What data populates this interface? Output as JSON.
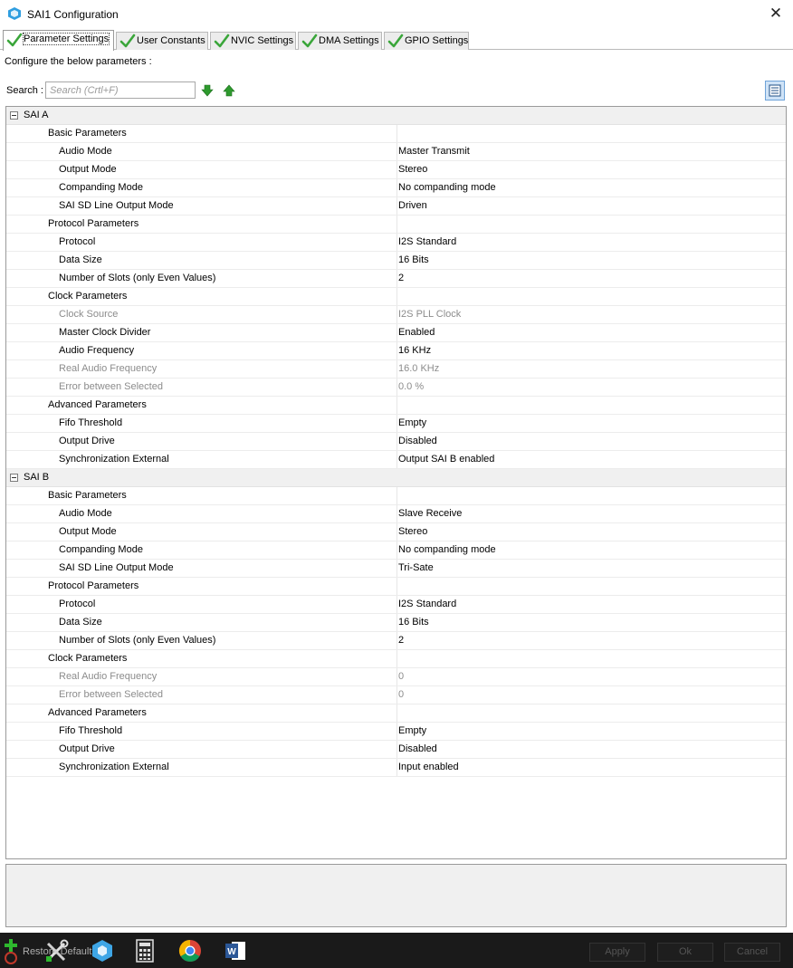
{
  "window": {
    "title": "SAI1 Configuration"
  },
  "tabs": [
    {
      "label": "Parameter Settings"
    },
    {
      "label": "User Constants"
    },
    {
      "label": "NVIC Settings"
    },
    {
      "label": "DMA Settings"
    },
    {
      "label": "GPIO Settings"
    }
  ],
  "configure_text": "Configure the below parameters :",
  "search": {
    "label": "Search :",
    "placeholder": "Search (Crtl+F)"
  },
  "sections": [
    {
      "title": "SAI A",
      "rows": [
        {
          "type": "group",
          "name": "Basic Parameters"
        },
        {
          "name": "Audio Mode",
          "value": "Master Transmit"
        },
        {
          "name": "Output Mode",
          "value": "Stereo"
        },
        {
          "name": "Companding Mode",
          "value": "No companding mode"
        },
        {
          "name": "SAI SD Line Output Mode",
          "value": "Driven"
        },
        {
          "type": "group",
          "name": "Protocol Parameters"
        },
        {
          "name": "Protocol",
          "value": "I2S Standard"
        },
        {
          "name": "Data Size",
          "value": "16 Bits"
        },
        {
          "name": "Number of Slots (only Even Values)",
          "value": "2"
        },
        {
          "type": "group",
          "name": "Clock Parameters"
        },
        {
          "name": "Clock Source",
          "value": "I2S PLL Clock",
          "disabled": true
        },
        {
          "name": "Master Clock Divider",
          "value": "Enabled"
        },
        {
          "name": "Audio Frequency",
          "value": "16 KHz"
        },
        {
          "name": "Real Audio Frequency",
          "value": "16.0 KHz",
          "disabled": true
        },
        {
          "name": "Error between Selected",
          "value": "0.0 %",
          "disabled": true
        },
        {
          "type": "group",
          "name": "Advanced Parameters"
        },
        {
          "name": "Fifo Threshold",
          "value": "Empty"
        },
        {
          "name": "Output Drive",
          "value": "Disabled"
        },
        {
          "name": "Synchronization External",
          "value": "Output SAI B enabled"
        }
      ]
    },
    {
      "title": "SAI B",
      "rows": [
        {
          "type": "group",
          "name": "Basic Parameters"
        },
        {
          "name": "Audio Mode",
          "value": "Slave Receive"
        },
        {
          "name": "Output Mode",
          "value": "Stereo"
        },
        {
          "name": "Companding Mode",
          "value": "No companding mode"
        },
        {
          "name": "SAI SD Line Output Mode",
          "value": "Tri-Sate"
        },
        {
          "type": "group",
          "name": "Protocol Parameters"
        },
        {
          "name": "Protocol",
          "value": "I2S Standard"
        },
        {
          "name": "Data Size",
          "value": "16 Bits"
        },
        {
          "name": "Number of Slots (only Even Values)",
          "value": "2"
        },
        {
          "type": "group",
          "name": "Clock Parameters"
        },
        {
          "name": "Real Audio Frequency",
          "value": "0",
          "disabled": true
        },
        {
          "name": "Error between Selected",
          "value": "0",
          "disabled": true
        },
        {
          "type": "group",
          "name": "Advanced Parameters"
        },
        {
          "name": "Fifo Threshold",
          "value": "Empty"
        },
        {
          "name": "Output Drive",
          "value": "Disabled"
        },
        {
          "name": "Synchronization External",
          "value": "Input enabled"
        }
      ]
    }
  ],
  "footer": {
    "restore_label": "Restore Default",
    "apply_label": "Apply",
    "ok_label": "Ok",
    "cancel_label": "Cancel"
  },
  "colors": {
    "check_green": "#3aa63a",
    "arrow_green": "#2e9a2e",
    "accent_blue": "#2f7fd1",
    "taskbar": "#1a1a1a"
  }
}
